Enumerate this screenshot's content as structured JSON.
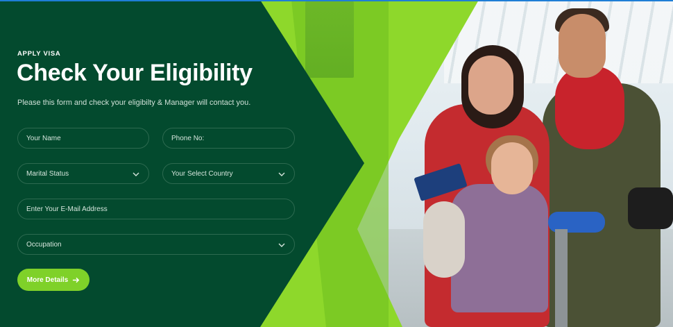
{
  "hero": {
    "eyebrow": "APPLY VISA",
    "title": "Check Your Eligibility",
    "subtitle": "Please this form and check your eligibilty & Manager will contact you."
  },
  "form": {
    "name_placeholder": "Your Name",
    "phone_placeholder": "Phone No:",
    "marital_status": "Marital Status",
    "country": "Your Select Country",
    "email_placeholder": "Enter Your E-Mail Address",
    "occupation": "Occupation",
    "submit_label": "More Details",
    "submit_icon": "arrow-right-icon"
  },
  "colors": {
    "dark_green": "#034a2e",
    "lime": "#8ed82b",
    "button": "#7fd129"
  }
}
